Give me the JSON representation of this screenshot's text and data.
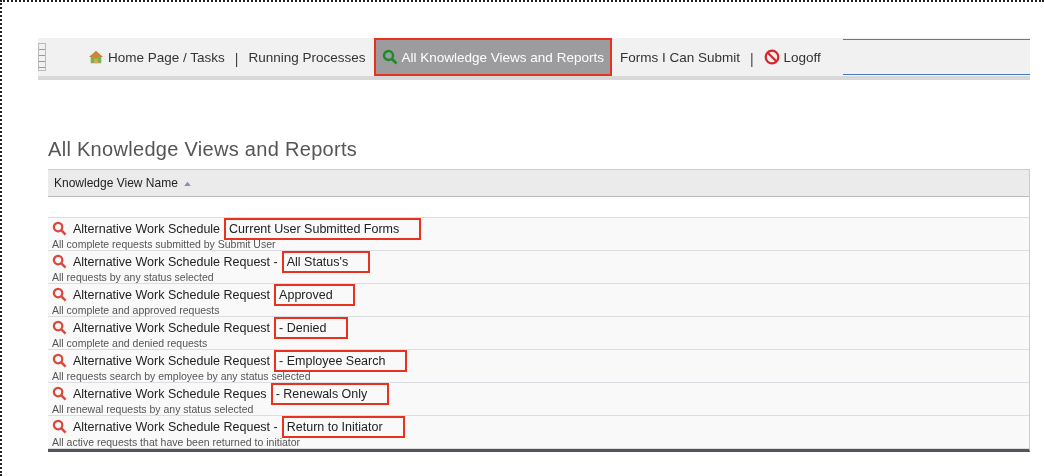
{
  "nav": {
    "items": [
      {
        "kind": "home",
        "label": "Home Page / Tasks",
        "selected": false,
        "annotated": false
      },
      {
        "kind": "separator",
        "label": "|"
      },
      {
        "kind": "plain",
        "label": "Running Processes",
        "selected": false,
        "annotated": false
      },
      {
        "kind": "views",
        "label": "All Knowledge Views and Reports",
        "selected": true,
        "annotated": true
      },
      {
        "kind": "plain",
        "label": "Forms I Can Submit",
        "selected": false,
        "annotated": false
      },
      {
        "kind": "separator",
        "label": "|"
      },
      {
        "kind": "logoff",
        "label": "Logoff",
        "selected": false,
        "annotated": false
      }
    ]
  },
  "page": {
    "title": "All Knowledge Views and Reports"
  },
  "table": {
    "columns": [
      {
        "label": "Knowledge View Name"
      }
    ],
    "rows": [
      {
        "name": "Alternative Work Schedule",
        "tag": "Current User Submitted Forms",
        "annotated": true,
        "description": "All complete requests submitted by Submit User"
      },
      {
        "name": "Alternative Work Schedule Request -",
        "tag": "All Status's",
        "annotated": true,
        "description": "All requests by any status selected"
      },
      {
        "name": "Alternative Work Schedule Request",
        "tag": "Approved",
        "annotated": true,
        "description": "All complete and approved requests"
      },
      {
        "name": "Alternative Work Schedule Request",
        "tag": "- Denied",
        "annotated": true,
        "description": "All complete and denied requests"
      },
      {
        "name": "Alternative Work Schedule Request",
        "tag": "- Employee Search",
        "annotated": true,
        "description": "All requests search by employee by any status selected"
      },
      {
        "name": "Alternative Work Schedule Reques",
        "tag": "- Renewals Only",
        "annotated": true,
        "description": "All renewal requests by any status selected"
      },
      {
        "name": "Alternative Work Schedule Request -",
        "tag": "Return to Initiator",
        "annotated": true,
        "description": "All active requests that have been returned to initiator"
      }
    ]
  }
}
